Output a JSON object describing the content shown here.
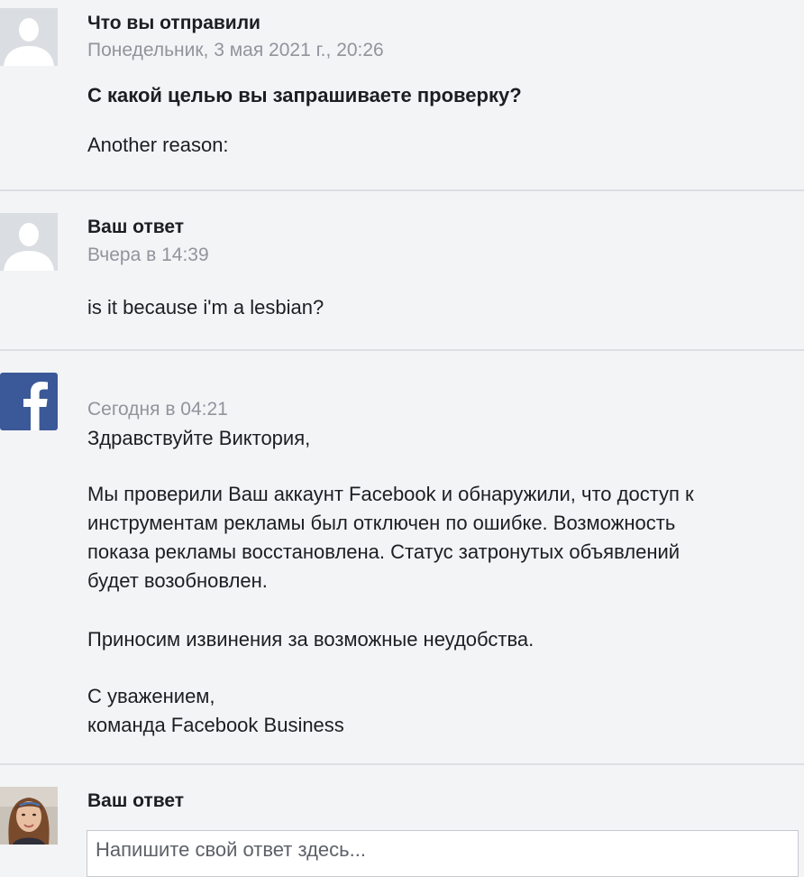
{
  "messages": [
    {
      "sender": "Что вы отправили",
      "time": "Понедельник, 3 мая 2021 г., 20:26",
      "question": "С какой целью вы запрашиваете проверку?",
      "answer": "Another reason:",
      "avatar_icon": "default-avatar-icon"
    },
    {
      "sender": "Ваш ответ",
      "time": "Вчера в 14:39",
      "body": "is it because i'm a lesbian?",
      "avatar_icon": "default-avatar-icon"
    },
    {
      "time": "Сегодня в 04:21",
      "greeting": "Здравствуйте Виктория,",
      "paragraph_lines": [
        "Мы проверили Ваш аккаунт Facebook и обнаружили, что доступ к",
        "инструментам рекламы был отключен по ошибке. Возможность",
        "показа рекламы восстановлена. Статус затронутых объявлений",
        "будет возобновлен."
      ],
      "apology": "Приносим извинения за возможные неудобства.",
      "closing": "С уважением,",
      "signature": "команда Facebook Business",
      "avatar_icon": "facebook-logo-icon",
      "brand_color": "#3b5998"
    }
  ],
  "reply": {
    "label": "Ваш ответ",
    "placeholder": "Напишите свой ответ здесь...",
    "avatar_icon": "user-photo-avatar"
  },
  "colors": {
    "background": "#f3f4f6",
    "divider": "#dcdee2",
    "timestamp": "#90949c",
    "text": "#1c1e21"
  }
}
